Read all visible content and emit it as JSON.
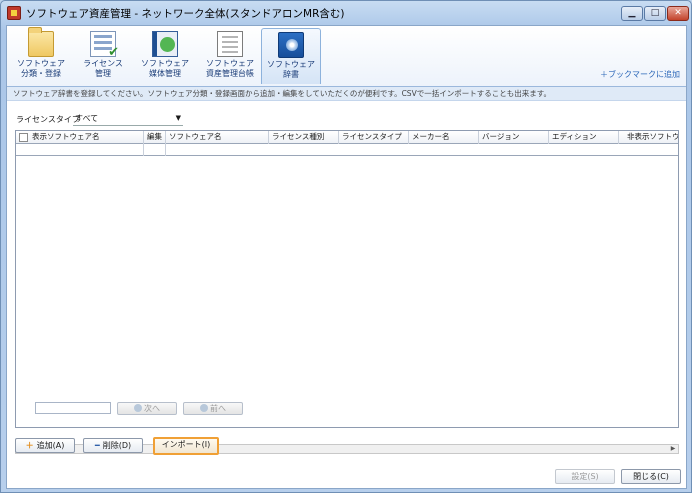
{
  "window": {
    "title": "ソフトウェア資産管理 - ネットワーク全体(スタンドアロンMR含む)"
  },
  "ribbon": {
    "items": [
      {
        "label1": "ソフトウェア",
        "label2": "分類・登録",
        "icon": "folder-icon"
      },
      {
        "label1": "ライセンス",
        "label2": "管理",
        "icon": "license-icon"
      },
      {
        "label1": "ソフトウェア",
        "label2": "媒体管理",
        "icon": "media-icon"
      },
      {
        "label1": "ソフトウェア",
        "label2": "資産管理台帳",
        "icon": "ledger-icon"
      },
      {
        "label1": "ソフトウェア",
        "label2": "辞書",
        "icon": "dictionary-icon",
        "active": true
      }
    ],
    "bookmark": "＋ブックマークに追加"
  },
  "info": "ソフトウェア辞書を登録してください。ソフトウェア分類・登録画面から追加・編集をしていただくのが便利です。CSVで一括インポートすることも出来ます。",
  "filter": {
    "label": "ライセンスタイプ",
    "value": "すべて"
  },
  "grid": {
    "columns": [
      "表示ソフトウェア名",
      "編集",
      "ソフトウェア名",
      "ライセンス種別",
      "ライセンスタイプ",
      "メーカー名",
      "バージョン",
      "エディション",
      "非表示ソフトウェア"
    ]
  },
  "pager": {
    "next": "次へ",
    "prev": "前へ"
  },
  "actions": {
    "add": "追加(A)",
    "delete": "削除(D)",
    "import": "インポート(I)"
  },
  "footer": {
    "settings": "設定(S)",
    "close": "閉じる(C)"
  },
  "colors": {
    "highlight": "#f0a035",
    "accent": "#2a66b8"
  }
}
